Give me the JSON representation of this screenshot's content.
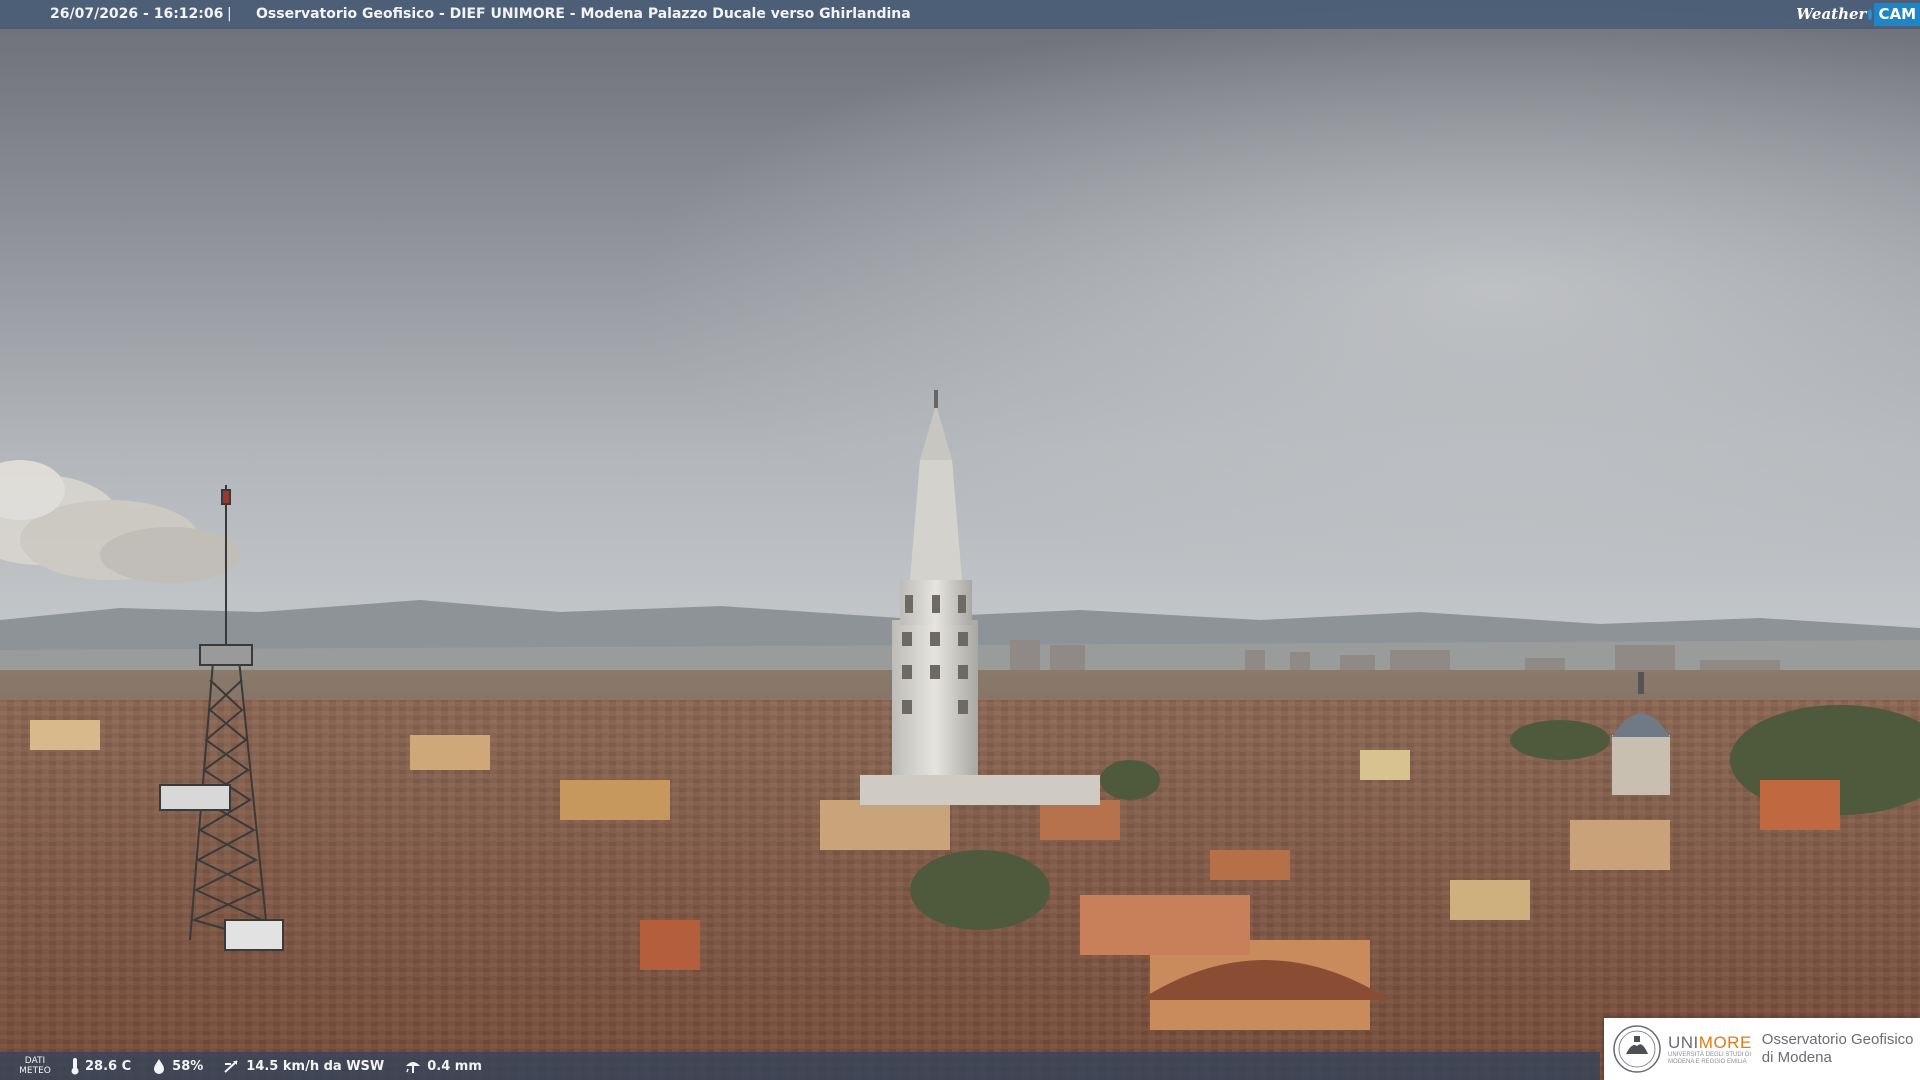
{
  "header": {
    "timestamp": "26/07/2026 - 16:12:06",
    "separator": "|",
    "caption": "Osservatorio Geofisico - DIEF UNIMORE - Modena Palazzo Ducale verso Ghirlandina",
    "logo": {
      "weather": "Weather",
      "cam": "CAM"
    }
  },
  "weather_bar": {
    "label": "DATI\nMETEO",
    "temperature": {
      "icon": "thermometer-icon",
      "value": "28.6 C"
    },
    "humidity": {
      "icon": "droplet-icon",
      "value": "58%"
    },
    "wind": {
      "icon": "wind-vane-icon",
      "value": "14.5 km/h da WSW"
    },
    "rain": {
      "icon": "rain-gauge-icon",
      "value": "0.4 mm"
    }
  },
  "institution": {
    "uni_prefix": "UNI",
    "uni_suffix": "MORE",
    "uni_subtitle_1": "UNIVERSITÀ DEGLI STUDI DI",
    "uni_subtitle_2": "MODENA E REGGIO EMILIA",
    "observatory_line1": "Osservatorio Geofisico",
    "observatory_line2": "di Modena"
  },
  "colors": {
    "accent_orange": "#e07b16",
    "cam_blue": "#1e86c8",
    "bar_blue": "#465c76"
  }
}
